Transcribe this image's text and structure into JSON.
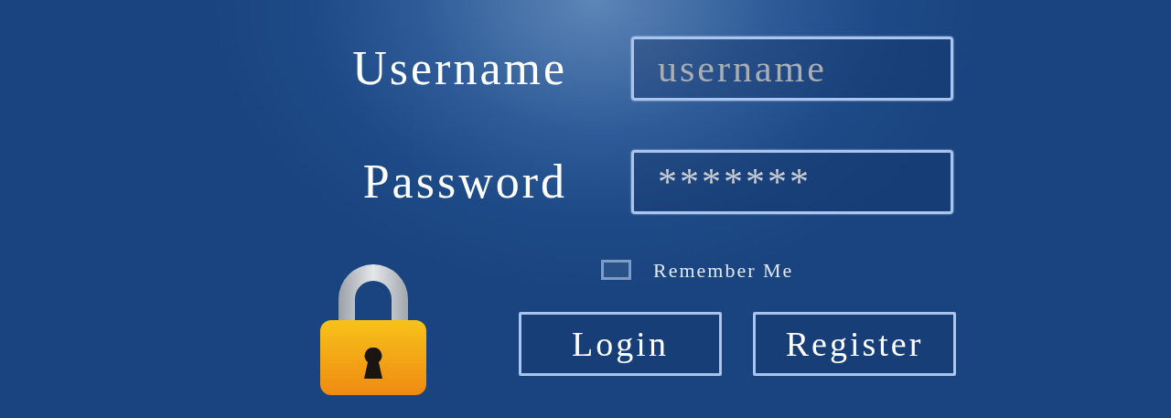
{
  "fields": [
    {
      "label": "Username",
      "placeholder": "username"
    },
    {
      "label": "Password",
      "value": "*******"
    }
  ],
  "remember": {
    "label": "Remember Me",
    "checked": false
  },
  "buttons": [
    "Login",
    "Register"
  ]
}
